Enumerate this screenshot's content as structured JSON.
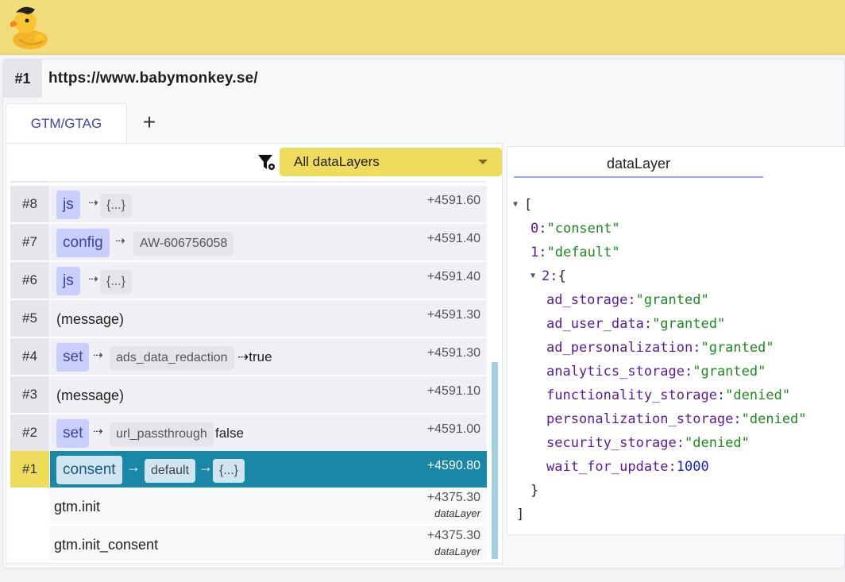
{
  "app": {
    "logo": "duck-logo-icon"
  },
  "url_row": {
    "number": "#1",
    "url": "https://www.babymonkey.se/"
  },
  "tabs": {
    "active_label": "GTM/GTAG",
    "add_label": "+"
  },
  "filter": {
    "icon": "filter-settings-icon",
    "select_value": "All dataLayers"
  },
  "events": [
    {
      "num": "#8",
      "pill": "js",
      "arrow": "⇢",
      "chips": [
        "{...}"
      ],
      "value": "",
      "time": "+4591.60"
    },
    {
      "num": "#7",
      "pill": "config",
      "arrow": "⇢",
      "chips": [
        "AW-606756058"
      ],
      "value": "",
      "time": "+4591.40"
    },
    {
      "num": "#6",
      "pill": "js",
      "arrow": "⇢",
      "chips": [
        "{...}"
      ],
      "value": "",
      "time": "+4591.40"
    },
    {
      "num": "#5",
      "plain": "(message)",
      "time": "+4591.30"
    },
    {
      "num": "#4",
      "pill": "set",
      "arrow": "⇢",
      "chips": [
        "ads_data_redaction"
      ],
      "value": "⇢true",
      "time": "+4591.30"
    },
    {
      "num": "#3",
      "plain": "(message)",
      "time": "+4591.10"
    },
    {
      "num": "#2",
      "pill": "set",
      "arrow": "⇢",
      "chips": [
        "url_passthrough"
      ],
      "value": "false",
      "time": "+4591.00"
    },
    {
      "num": "#1",
      "pill": "consent",
      "arrow": "→",
      "chips": [
        "default",
        "{...}"
      ],
      "arrow2": "→",
      "time": "+4590.80",
      "selected": true
    }
  ],
  "gtm_events": [
    {
      "label": "gtm.init",
      "time": "+4375.30",
      "source": "dataLayer"
    },
    {
      "label": "gtm.init_consent",
      "time": "+4375.30",
      "source": "dataLayer"
    }
  ],
  "right": {
    "tab_label": "dataLayer",
    "json": {
      "open_bracket": "[",
      "close_bracket": "]",
      "items": [
        {
          "key": "0:",
          "value": "\"consent\""
        },
        {
          "key": "1:",
          "value": "\"default\""
        }
      ],
      "obj_key": "2:",
      "obj_open": "{",
      "obj_close": "}",
      "obj_entries": [
        {
          "key": "ad_storage:",
          "value": "\"granted\"",
          "type": "str"
        },
        {
          "key": "ad_user_data:",
          "value": "\"granted\"",
          "type": "str"
        },
        {
          "key": "ad_personalization:",
          "value": "\"granted\"",
          "type": "str"
        },
        {
          "key": "analytics_storage:",
          "value": "\"granted\"",
          "type": "str"
        },
        {
          "key": "functionality_storage:",
          "value": "\"denied\"",
          "type": "str"
        },
        {
          "key": "personalization_storage:",
          "value": "\"denied\"",
          "type": "str"
        },
        {
          "key": "security_storage:",
          "value": "\"denied\"",
          "type": "str"
        },
        {
          "key": "wait_for_update:",
          "value": "1000",
          "type": "num"
        }
      ]
    }
  },
  "colors": {
    "topbar": "#f0dc78",
    "accent": "#3b44a8",
    "selected": "#1b87a6",
    "highlight": "#f0dc5c"
  }
}
